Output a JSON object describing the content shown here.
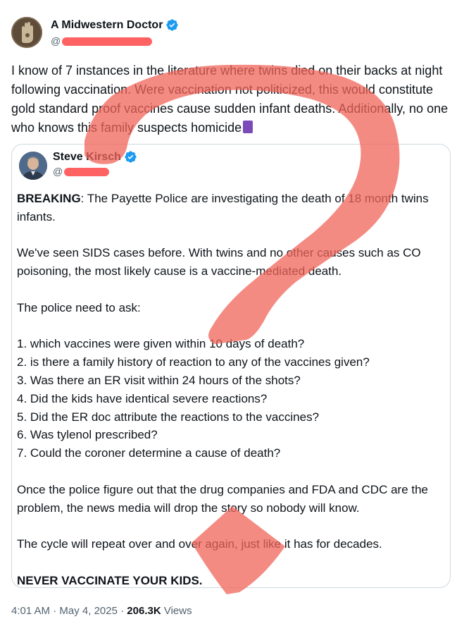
{
  "author": {
    "display_name": "A Midwestern Doctor",
    "handle_prefix": "@"
  },
  "post": {
    "text": "I know of 7 instances in the literature where twins died on their backs at night following vaccination. Were vaccination not politicized, this would constitute gold standard proof vaccines cause sudden infant deaths. Additionally, no one who knows this family suspects homicide",
    "emoji_icon": "thread-spool-icon"
  },
  "quoted": {
    "display_name": "Steve Kirsch",
    "handle_prefix": "@",
    "breaking_label": "BREAKING",
    "breaking_text": ": The Payette Police are investigating the death of 18 month twins infants.",
    "para2": "We've seen SIDS cases before. With twins and no other causes such as CO poisoning, the most likely cause is a vaccine-mediated death.",
    "para3": "The police need to ask:",
    "questions": [
      "1. which vaccines were given within 10 days of death?",
      "2. is there a family history of reaction to any of the vaccines given?",
      "3. Was there an ER visit within 24 hours of the shots?",
      "4. Did the kids have identical severe reactions?",
      "5. Did the ER doc attribute the reactions to the vaccines?",
      "6. Was tylenol prescribed?",
      "7. Could the coroner determine a cause of death?"
    ],
    "para5": "Once the police figure out that the drug companies and FDA and CDC are the problem, the news media will drop the story so nobody will know.",
    "para6": "The cycle will repeat over and over again, just like it has for decades.",
    "closing": "NEVER VACCINATE YOUR KIDS."
  },
  "footer": {
    "time": "4:01 AM",
    "sep1": " · ",
    "date": "May 4, 2025",
    "sep2": " · ",
    "views_count": "206.3K",
    "views_label": " Views"
  },
  "colors": {
    "verified_blue": "#1d9bf0",
    "overlay_red": "#f0645a",
    "redaction_red": "#ff3b3b",
    "secondary_text": "#536471"
  }
}
